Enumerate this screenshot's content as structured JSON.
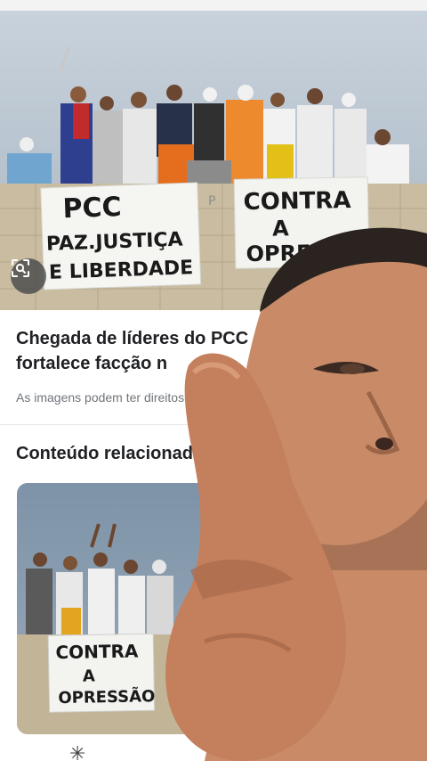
{
  "article": {
    "title_line1": "Chegada de líderes do PCC",
    "title_line2": "fortalece facção n",
    "caption": "As imagens podem ter direitos",
    "lens_icon": "lens-search-icon"
  },
  "hero_image": {
    "banner_left": [
      "PCC",
      "PAZ.JUSTIÇA",
      "E LIBERDADE"
    ],
    "banner_right": [
      "CONTRA",
      "A",
      "OPRESSÃO"
    ]
  },
  "related": {
    "heading": "Conteúdo relacionado",
    "card_banner": [
      "CONTRA",
      "A",
      "OPRESSÃO"
    ]
  },
  "bottom_nav": {
    "icon": "sparkle-icon"
  },
  "colors": {
    "text_primary": "#202124",
    "text_secondary": "#70757a",
    "skin": "#c98b67"
  }
}
